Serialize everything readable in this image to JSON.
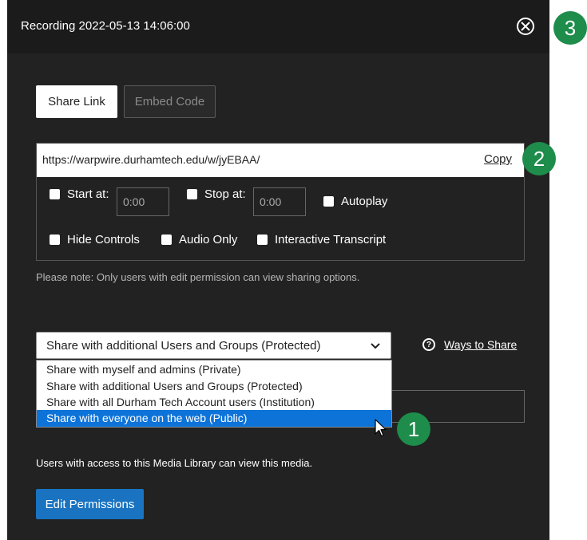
{
  "dialog": {
    "title": "Recording 2022-05-13 14:06:00",
    "close_icon": "close-circle-icon"
  },
  "tabs": [
    {
      "label": "Share Link",
      "active": true
    },
    {
      "label": "Embed Code",
      "active": false
    }
  ],
  "share_link": {
    "url": "https://warpwire.durhamtech.edu/w/jyEBAA/",
    "copy_label": "Copy"
  },
  "options": {
    "start_at": {
      "label": "Start at:",
      "value": "0:00",
      "checked": false
    },
    "stop_at": {
      "label": "Stop at:",
      "value": "0:00",
      "checked": false
    },
    "autoplay": {
      "label": "Autoplay",
      "checked": false
    },
    "hide_controls": {
      "label": "Hide Controls",
      "checked": false
    },
    "audio_only": {
      "label": "Audio Only",
      "checked": false
    },
    "interactive_transcript": {
      "label": "Interactive Transcript",
      "checked": false
    }
  },
  "note": "Please note: Only users with edit permission can view sharing options.",
  "sharing": {
    "selected": "Share with additional Users and Groups (Protected)",
    "options": [
      "Share with myself and admins (Private)",
      "Share with additional Users and Groups (Protected)",
      "Share with all Durham Tech Account users (Institution)",
      "Share with everyone on the web (Public)"
    ],
    "highlighted_index": 3,
    "ways_label": "Ways to Share",
    "help_icon": "question-circle-icon"
  },
  "access_note": "Users with access to this Media Library can view this media.",
  "edit_permissions_label": "Edit Permissions",
  "callouts": [
    "1",
    "2",
    "3"
  ],
  "colors": {
    "accent_blue": "#1973c1",
    "highlight_blue": "#0d73d9",
    "callout_green": "#1e8c4a",
    "modal_bg": "#222222"
  }
}
